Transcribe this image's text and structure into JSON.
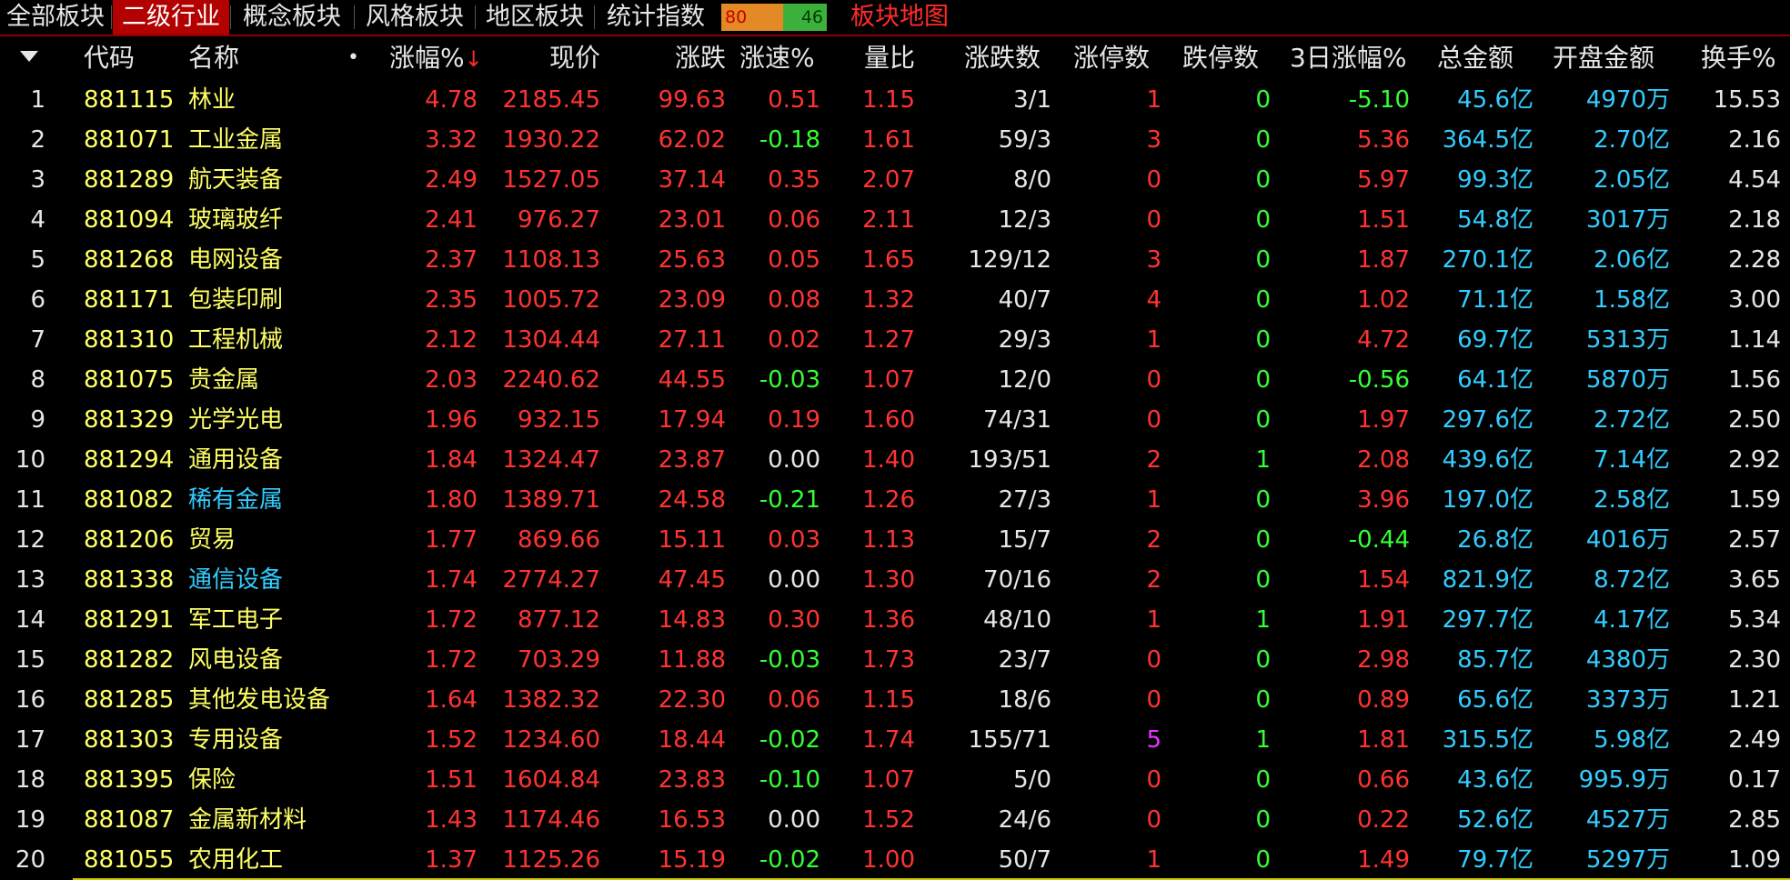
{
  "tabs": [
    {
      "label": "全部板块",
      "active": false
    },
    {
      "label": "二级行业",
      "active": true
    },
    {
      "label": "概念板块",
      "active": false
    },
    {
      "label": "风格板块",
      "active": false
    },
    {
      "label": "地区板块",
      "active": false
    },
    {
      "label": "统计指数",
      "active": false
    }
  ],
  "breadth": {
    "up": "80",
    "down": "46"
  },
  "map_link": "板块地图",
  "header": {
    "code": "代码",
    "name": "名称",
    "dot": "•",
    "pct": "涨幅%",
    "pct_sort": "↓",
    "price": "现价",
    "change": "涨跌",
    "speed": "涨速%",
    "volratio": "量比",
    "updown": "涨跌数",
    "limitup": "涨停数",
    "limitdown": "跌停数",
    "pct3d": "3日涨幅%",
    "amount": "总金额",
    "open_amount": "开盘金额",
    "turnover": "换手%"
  },
  "colors": {
    "red": "#ff3333",
    "green": "#33ff33",
    "white": "#e6e6e6",
    "yellow": "#ffff66",
    "cyan": "#33ccff",
    "magenta": "#e633ff",
    "active_tab": "#b30000"
  },
  "rows": [
    {
      "idx": "1",
      "code": "881115",
      "name": "林业",
      "name_color": "yellow",
      "pct": "4.78",
      "price": "2185.45",
      "change": "99.63",
      "speed": "0.51",
      "volratio": "1.15",
      "updown": "3/1",
      "limitup": "1",
      "limitdown": "0",
      "pct3d": "-5.10",
      "amount": "45.6亿",
      "open_amount": "4970万",
      "turnover": "15.53"
    },
    {
      "idx": "2",
      "code": "881071",
      "name": "工业金属",
      "name_color": "yellow",
      "pct": "3.32",
      "price": "1930.22",
      "change": "62.02",
      "speed": "-0.18",
      "volratio": "1.61",
      "updown": "59/3",
      "limitup": "3",
      "limitdown": "0",
      "pct3d": "5.36",
      "amount": "364.5亿",
      "open_amount": "2.70亿",
      "turnover": "2.16"
    },
    {
      "idx": "3",
      "code": "881289",
      "name": "航天装备",
      "name_color": "yellow",
      "pct": "2.49",
      "price": "1527.05",
      "change": "37.14",
      "speed": "0.35",
      "volratio": "2.07",
      "updown": "8/0",
      "limitup": "0",
      "limitdown": "0",
      "pct3d": "5.97",
      "amount": "99.3亿",
      "open_amount": "2.05亿",
      "turnover": "4.54"
    },
    {
      "idx": "4",
      "code": "881094",
      "name": "玻璃玻纤",
      "name_color": "yellow",
      "pct": "2.41",
      "price": "976.27",
      "change": "23.01",
      "speed": "0.06",
      "volratio": "2.11",
      "updown": "12/3",
      "limitup": "0",
      "limitdown": "0",
      "pct3d": "1.51",
      "amount": "54.8亿",
      "open_amount": "3017万",
      "turnover": "2.18"
    },
    {
      "idx": "5",
      "code": "881268",
      "name": "电网设备",
      "name_color": "yellow",
      "pct": "2.37",
      "price": "1108.13",
      "change": "25.63",
      "speed": "0.05",
      "volratio": "1.65",
      "updown": "129/12",
      "limitup": "3",
      "limitdown": "0",
      "pct3d": "1.87",
      "amount": "270.1亿",
      "open_amount": "2.06亿",
      "turnover": "2.28"
    },
    {
      "idx": "6",
      "code": "881171",
      "name": "包装印刷",
      "name_color": "yellow",
      "pct": "2.35",
      "price": "1005.72",
      "change": "23.09",
      "speed": "0.08",
      "volratio": "1.32",
      "updown": "40/7",
      "limitup": "4",
      "limitdown": "0",
      "pct3d": "1.02",
      "amount": "71.1亿",
      "open_amount": "1.58亿",
      "turnover": "3.00"
    },
    {
      "idx": "7",
      "code": "881310",
      "name": "工程机械",
      "name_color": "yellow",
      "pct": "2.12",
      "price": "1304.44",
      "change": "27.11",
      "speed": "0.02",
      "volratio": "1.27",
      "updown": "29/3",
      "limitup": "1",
      "limitdown": "0",
      "pct3d": "4.72",
      "amount": "69.7亿",
      "open_amount": "5313万",
      "turnover": "1.14"
    },
    {
      "idx": "8",
      "code": "881075",
      "name": "贵金属",
      "name_color": "yellow",
      "pct": "2.03",
      "price": "2240.62",
      "change": "44.55",
      "speed": "-0.03",
      "volratio": "1.07",
      "updown": "12/0",
      "limitup": "0",
      "limitdown": "0",
      "pct3d": "-0.56",
      "amount": "64.1亿",
      "open_amount": "5870万",
      "turnover": "1.56"
    },
    {
      "idx": "9",
      "code": "881329",
      "name": "光学光电",
      "name_color": "yellow",
      "pct": "1.96",
      "price": "932.15",
      "change": "17.94",
      "speed": "0.19",
      "volratio": "1.60",
      "updown": "74/31",
      "limitup": "0",
      "limitdown": "0",
      "pct3d": "1.97",
      "amount": "297.6亿",
      "open_amount": "2.72亿",
      "turnover": "2.50"
    },
    {
      "idx": "10",
      "code": "881294",
      "name": "通用设备",
      "name_color": "yellow",
      "pct": "1.84",
      "price": "1324.47",
      "change": "23.87",
      "speed": "0.00",
      "volratio": "1.40",
      "updown": "193/51",
      "limitup": "2",
      "limitdown": "1",
      "pct3d": "2.08",
      "amount": "439.6亿",
      "open_amount": "7.14亿",
      "turnover": "2.92"
    },
    {
      "idx": "11",
      "code": "881082",
      "name": "稀有金属",
      "name_color": "cyan",
      "pct": "1.80",
      "price": "1389.71",
      "change": "24.58",
      "speed": "-0.21",
      "volratio": "1.26",
      "updown": "27/3",
      "limitup": "1",
      "limitdown": "0",
      "pct3d": "3.96",
      "amount": "197.0亿",
      "open_amount": "2.58亿",
      "turnover": "1.59"
    },
    {
      "idx": "12",
      "code": "881206",
      "name": "贸易",
      "name_color": "yellow",
      "pct": "1.77",
      "price": "869.66",
      "change": "15.11",
      "speed": "0.03",
      "volratio": "1.13",
      "updown": "15/7",
      "limitup": "2",
      "limitdown": "0",
      "pct3d": "-0.44",
      "amount": "26.8亿",
      "open_amount": "4016万",
      "turnover": "2.57"
    },
    {
      "idx": "13",
      "code": "881338",
      "name": "通信设备",
      "name_color": "cyan",
      "pct": "1.74",
      "price": "2774.27",
      "change": "47.45",
      "speed": "0.00",
      "volratio": "1.30",
      "updown": "70/16",
      "limitup": "2",
      "limitdown": "0",
      "pct3d": "1.54",
      "amount": "821.9亿",
      "open_amount": "8.72亿",
      "turnover": "3.65"
    },
    {
      "idx": "14",
      "code": "881291",
      "name": "军工电子",
      "name_color": "yellow",
      "pct": "1.72",
      "price": "877.12",
      "change": "14.83",
      "speed": "0.30",
      "volratio": "1.36",
      "updown": "48/10",
      "limitup": "1",
      "limitdown": "1",
      "pct3d": "1.91",
      "amount": "297.7亿",
      "open_amount": "4.17亿",
      "turnover": "5.34"
    },
    {
      "idx": "15",
      "code": "881282",
      "name": "风电设备",
      "name_color": "yellow",
      "pct": "1.72",
      "price": "703.29",
      "change": "11.88",
      "speed": "-0.03",
      "volratio": "1.73",
      "updown": "23/7",
      "limitup": "0",
      "limitdown": "0",
      "pct3d": "2.98",
      "amount": "85.7亿",
      "open_amount": "4380万",
      "turnover": "2.30"
    },
    {
      "idx": "16",
      "code": "881285",
      "name": "其他发电设备",
      "name_color": "yellow",
      "pct": "1.64",
      "price": "1382.32",
      "change": "22.30",
      "speed": "0.06",
      "volratio": "1.15",
      "updown": "18/6",
      "limitup": "0",
      "limitdown": "0",
      "pct3d": "0.89",
      "amount": "65.6亿",
      "open_amount": "3373万",
      "turnover": "1.21"
    },
    {
      "idx": "17",
      "code": "881303",
      "name": "专用设备",
      "name_color": "yellow",
      "pct": "1.52",
      "price": "1234.60",
      "change": "18.44",
      "speed": "-0.02",
      "volratio": "1.74",
      "updown": "155/71",
      "limitup": "5",
      "limitdown": "1",
      "pct3d": "1.81",
      "amount": "315.5亿",
      "open_amount": "5.98亿",
      "turnover": "2.49"
    },
    {
      "idx": "18",
      "code": "881395",
      "name": "保险",
      "name_color": "yellow",
      "pct": "1.51",
      "price": "1604.84",
      "change": "23.83",
      "speed": "-0.10",
      "volratio": "1.07",
      "updown": "5/0",
      "limitup": "0",
      "limitdown": "0",
      "pct3d": "0.66",
      "amount": "43.6亿",
      "open_amount": "995.9万",
      "turnover": "0.17"
    },
    {
      "idx": "19",
      "code": "881087",
      "name": "金属新材料",
      "name_color": "yellow",
      "pct": "1.43",
      "price": "1174.46",
      "change": "16.53",
      "speed": "0.00",
      "volratio": "1.52",
      "updown": "24/6",
      "limitup": "0",
      "limitdown": "0",
      "pct3d": "0.22",
      "amount": "52.6亿",
      "open_amount": "4527万",
      "turnover": "2.85"
    },
    {
      "idx": "20",
      "code": "881055",
      "name": "农用化工",
      "name_color": "yellow",
      "pct": "1.37",
      "price": "1125.26",
      "change": "15.19",
      "speed": "-0.02",
      "volratio": "1.00",
      "updown": "50/7",
      "limitup": "1",
      "limitdown": "0",
      "pct3d": "1.49",
      "amount": "79.7亿",
      "open_amount": "5297万",
      "turnover": "1.09"
    }
  ]
}
